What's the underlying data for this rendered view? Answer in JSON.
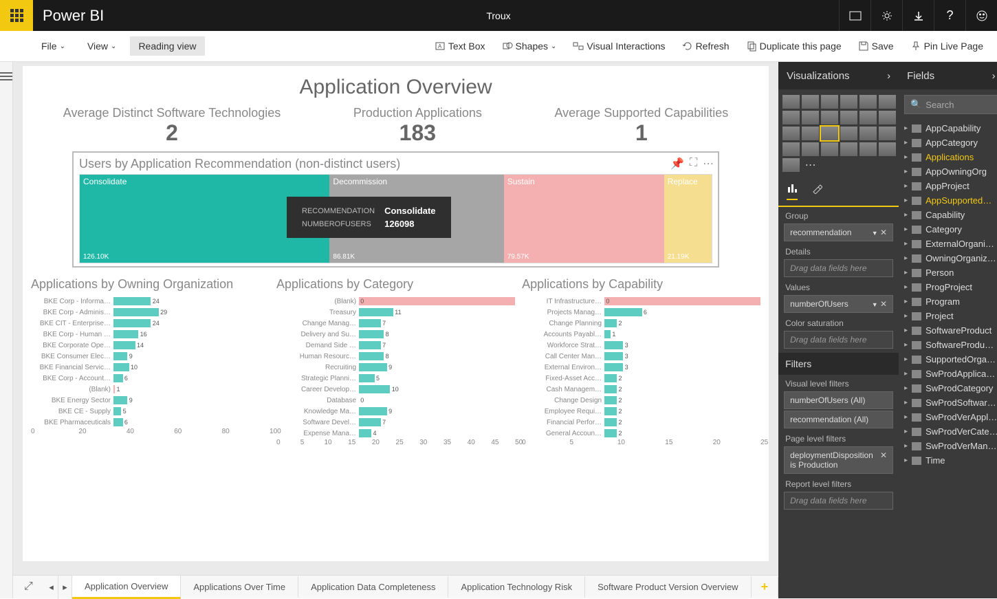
{
  "app": {
    "title": "Power BI",
    "document": "Troux"
  },
  "ribbon": {
    "file": "File",
    "view": "View",
    "reading": "Reading view",
    "textbox": "Text Box",
    "shapes": "Shapes",
    "visual_interactions": "Visual Interactions",
    "refresh": "Refresh",
    "duplicate": "Duplicate this page",
    "save": "Save",
    "pin": "Pin Live Page"
  },
  "report": {
    "title": "Application Overview",
    "kpis": [
      {
        "label": "Average Distinct Software Technologies",
        "value": "2"
      },
      {
        "label": "Production Applications",
        "value": "183"
      },
      {
        "label": "Average Supported Capabilities",
        "value": "1"
      }
    ],
    "treemap": {
      "title": "Users by Application Recommendation (non-distinct users)",
      "tooltip": {
        "rec_label": "RECOMMENDATION",
        "rec_value": "Consolidate",
        "num_label": "NUMBEROFUSERS",
        "num_value": "126098"
      }
    }
  },
  "chart_data": {
    "treemap": {
      "type": "treemap",
      "title": "Users by Application Recommendation (non-distinct users)",
      "series": [
        {
          "name": "Consolidate",
          "value": 126100,
          "footnote": "126.10K",
          "color": "#1fb8a6"
        },
        {
          "name": "Decommission",
          "value": 86810,
          "footnote": "86.81K",
          "color": "#a6a6a6"
        },
        {
          "name": "Sustain",
          "value": 79570,
          "footnote": "79.57K",
          "color": "#f4b0b0"
        },
        {
          "name": "Replace",
          "value": 21190,
          "footnote": "21.19K",
          "color": "#f5de8f"
        }
      ]
    },
    "org": {
      "type": "bar",
      "title": "Applications by Owning Organization",
      "categories": [
        "BKE Corp - Informa…",
        "BKE Corp - Adminis…",
        "BKE CIT - Enterprise…",
        "BKE Corp - Human …",
        "BKE Corporate Ope…",
        "BKE Consumer Elec…",
        "BKE Financial Servic…",
        "BKE Corp - Account…",
        "(Blank)",
        "BKE Energy Sector",
        "BKE CE - Supply",
        "BKE Pharmaceuticals"
      ],
      "values": [
        24,
        29,
        24,
        16,
        14,
        9,
        10,
        6,
        1,
        9,
        5,
        6
      ],
      "xlim": [
        0,
        100
      ],
      "xticks": [
        0,
        20,
        40,
        60,
        80,
        100
      ],
      "colors": [
        "t",
        "t",
        "t",
        "t",
        "t",
        "t",
        "t",
        "t",
        "r",
        "t",
        "t",
        "t"
      ]
    },
    "cat": {
      "type": "bar",
      "title": "Applications by Category",
      "categories": [
        "(Blank)",
        "Treasury",
        "Change Manag…",
        "Delivery and Su…",
        "Demand Side …",
        "Human Resourc…",
        "Recruiting",
        "Strategic Planni…",
        "Career Develop…",
        "Database",
        "Knowledge Ma…",
        "Software Devel…",
        "Expense Mana…"
      ],
      "values": [
        0,
        11,
        7,
        8,
        7,
        8,
        9,
        5,
        10,
        0,
        9,
        7,
        4
      ],
      "xlim": [
        0,
        50
      ],
      "xticks": [
        0,
        5,
        10,
        15,
        20,
        25,
        30,
        35,
        40,
        45,
        50
      ],
      "pink_bg_index": 0
    },
    "cap": {
      "type": "bar",
      "title": "Applications by Capability",
      "categories": [
        "IT Infrastructure…",
        "Projects Manag…",
        "Change Planning",
        "Accounts Payabl…",
        "Workforce Strat…",
        "Call Center Man…",
        "External Environ…",
        "Fixed-Asset Acc…",
        "Cash Managem…",
        "Change Design",
        "Employee Requi…",
        "Financial Perfor…",
        "General Accoun…"
      ],
      "values": [
        0,
        6,
        2,
        1,
        3,
        3,
        3,
        2,
        2,
        2,
        2,
        2,
        2
      ],
      "xlim": [
        0,
        25
      ],
      "xticks": [
        0,
        5,
        10,
        15,
        20,
        25
      ],
      "pink_bg_index": 0
    }
  },
  "tabs": [
    "Application Overview",
    "Applications Over Time",
    "Application Data Completeness",
    "Application Technology Risk",
    "Software Product Version Overview"
  ],
  "viz_panel": {
    "title": "Visualizations",
    "group_label": "Group",
    "group_field": "recommendation",
    "details_label": "Details",
    "details_placeholder": "Drag data fields here",
    "values_label": "Values",
    "values_field": "numberOfUsers",
    "colorsat_label": "Color saturation",
    "colorsat_placeholder": "Drag data fields here",
    "filters_title": "Filters",
    "vlf_label": "Visual level filters",
    "vlf1": "numberOfUsers (All)",
    "vlf2": "recommendation (All)",
    "plf_label": "Page level filters",
    "plf1_line1": "deploymentDisposition",
    "plf1_line2": "is Production",
    "rlf_label": "Report level filters",
    "rlf_placeholder": "Drag data fields here"
  },
  "fields_panel": {
    "title": "Fields",
    "search_placeholder": "Search",
    "items": [
      "AppCapability",
      "AppCategory",
      "Applications",
      "AppOwningOrg",
      "AppProject",
      "AppSupported…",
      "Capability",
      "Category",
      "ExternalOrgani…",
      "OwningOrganiz…",
      "Person",
      "ProgProject",
      "Program",
      "Project",
      "SoftwareProduct",
      "SoftwareProdu…",
      "SupportedOrga…",
      "SwProdApplica…",
      "SwProdCategory",
      "SwProdSoftwar…",
      "SwProdVerAppl…",
      "SwProdVerCate…",
      "SwProdVerMan…",
      "Time"
    ],
    "active": [
      2,
      5
    ]
  }
}
